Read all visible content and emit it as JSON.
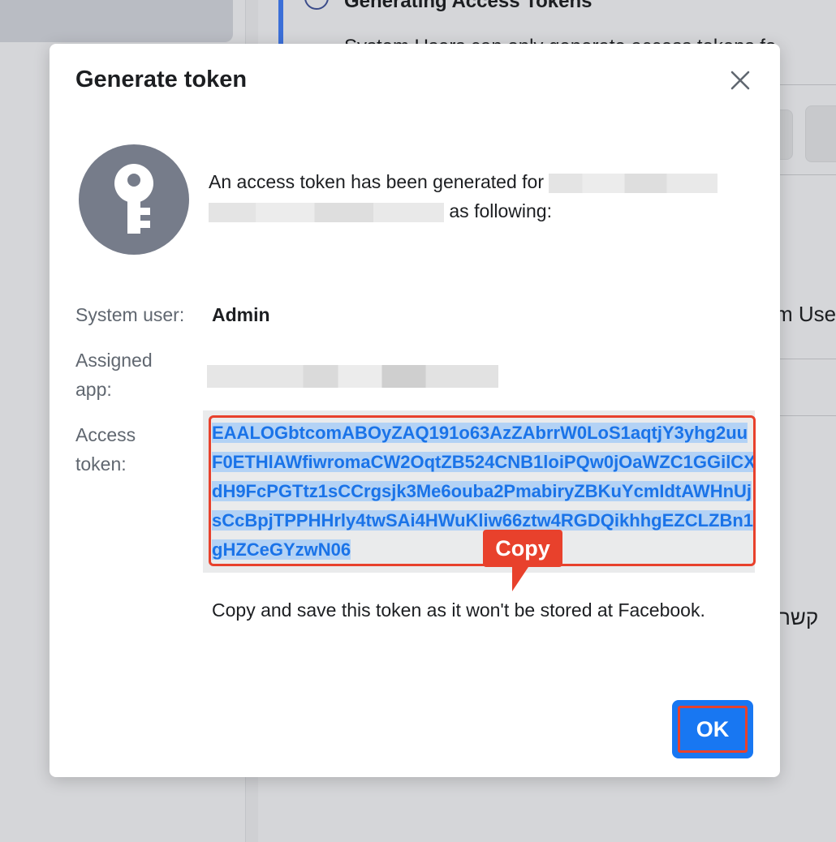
{
  "background": {
    "heading": "Generating Access Tokens",
    "subtext": "System Users can only generate access tokens fo",
    "right_text": "m Use",
    "hebrew_text": "קשר"
  },
  "dialog": {
    "title": "Generate token",
    "close_icon": "close-icon",
    "key_icon": "key-icon",
    "intro_prefix": "An access token has been generated for",
    "intro_suffix": "as following:",
    "system_user_label": "System user:",
    "system_user_value": "Admin",
    "assigned_app_label": "Assigned app:",
    "access_token_label": "Access token:",
    "access_token_value": "EAALOGbtcomABOyZAQ191o63AzZAbrrW0LoS1aqtjY3yhg2uuF0ETHlAWfiwromaCW2OqtZB524CNB1loiPQw0jOaWZC1GGilCXdH9FcPGTtz1sCCrgsjk3Me6ouba2PmabiryZBKuYcmIdtAWHnUjsCcBpjTPPHHrly4twSAi4HWuKliw66ztw4RGDQikhhgEZCLZBn1gHZCeGYzwN06",
    "copy_label": "Copy",
    "note": "Copy and save this token as it won't be stored at Facebook.",
    "ok_label": "OK"
  },
  "colors": {
    "accent": "#1877f2",
    "highlight_border": "#e8412c",
    "token_text": "#1a73e8",
    "key_circle": "#767c8a"
  }
}
